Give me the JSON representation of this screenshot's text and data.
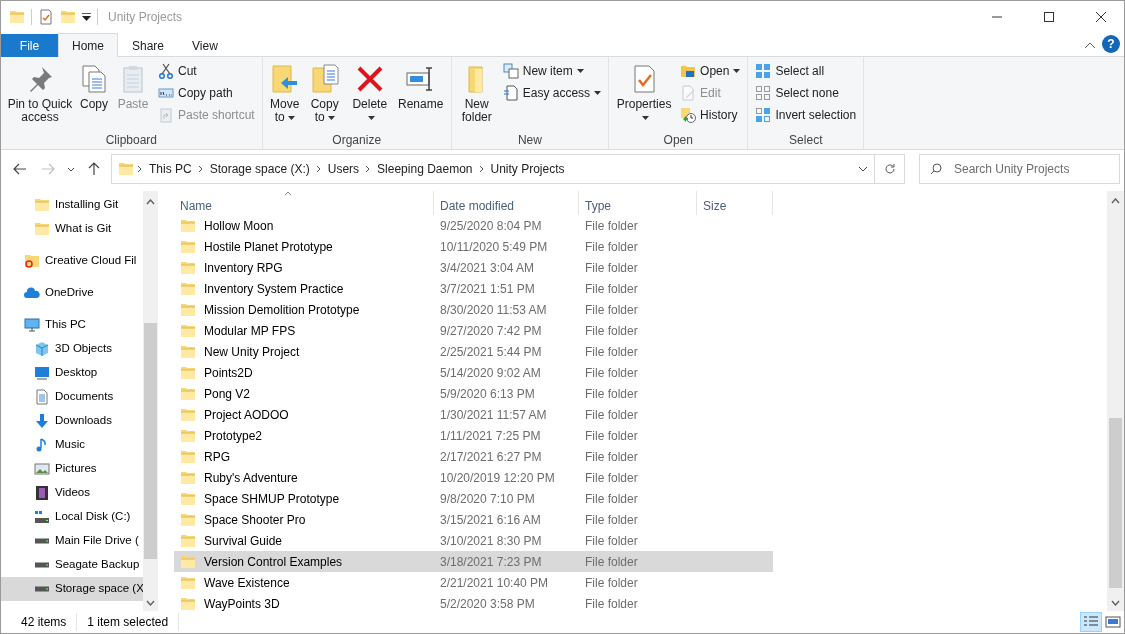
{
  "window": {
    "title": "Unity Projects"
  },
  "ribbon_tabs": [
    {
      "label": "File",
      "kind": "file",
      "selected": false
    },
    {
      "label": "Home",
      "kind": "tab",
      "selected": true
    },
    {
      "label": "Share",
      "kind": "tab",
      "selected": false
    },
    {
      "label": "View",
      "kind": "tab",
      "selected": false
    }
  ],
  "help_button": "?",
  "ribbon": {
    "groups": [
      {
        "label": "Clipboard",
        "items": [
          {
            "label": "Pin to Quick access",
            "kind": "large",
            "disabled": false,
            "dropdown": false
          },
          {
            "label": "Copy",
            "kind": "large",
            "disabled": false,
            "dropdown": false
          },
          {
            "label": "Paste",
            "kind": "large",
            "disabled": true,
            "dropdown": false
          },
          {
            "label": "Cut",
            "kind": "small",
            "disabled": false,
            "dropdown": false
          },
          {
            "label": "Copy path",
            "kind": "small",
            "disabled": false,
            "dropdown": false
          },
          {
            "label": "Paste shortcut",
            "kind": "small",
            "disabled": true,
            "dropdown": false
          }
        ]
      },
      {
        "label": "Organize",
        "items": [
          {
            "label": "Move to",
            "kind": "large",
            "disabled": false,
            "dropdown": true
          },
          {
            "label": "Copy to",
            "kind": "large",
            "disabled": false,
            "dropdown": true
          },
          {
            "label": "Delete",
            "kind": "large",
            "disabled": false,
            "dropdown": true
          },
          {
            "label": "Rename",
            "kind": "large",
            "disabled": false,
            "dropdown": false
          }
        ]
      },
      {
        "label": "New",
        "items": [
          {
            "label": "New folder",
            "kind": "large",
            "disabled": false,
            "dropdown": false
          },
          {
            "label": "New item",
            "kind": "small",
            "disabled": false,
            "dropdown": true
          },
          {
            "label": "Easy access",
            "kind": "small",
            "disabled": false,
            "dropdown": true
          }
        ]
      },
      {
        "label": "Open",
        "items": [
          {
            "label": "Properties",
            "kind": "large",
            "disabled": false,
            "dropdown": true
          },
          {
            "label": "Open",
            "kind": "small",
            "disabled": false,
            "dropdown": true
          },
          {
            "label": "Edit",
            "kind": "small",
            "disabled": true,
            "dropdown": false
          },
          {
            "label": "History",
            "kind": "small",
            "disabled": false,
            "dropdown": false
          }
        ]
      },
      {
        "label": "Select",
        "items": [
          {
            "label": "Select all",
            "kind": "small",
            "disabled": false,
            "dropdown": false
          },
          {
            "label": "Select none",
            "kind": "small",
            "disabled": false,
            "dropdown": false
          },
          {
            "label": "Invert selection",
            "kind": "small",
            "disabled": false,
            "dropdown": false
          }
        ]
      }
    ]
  },
  "address_bar": {
    "breadcrumbs": [
      "This PC",
      "Storage space (X:)",
      "Users",
      "Sleeping Daemon",
      "Unity Projects"
    ],
    "forward_disabled": true
  },
  "search": {
    "placeholder": "Search Unity Projects"
  },
  "navigation": {
    "pinned": [
      {
        "label": "Installing Git",
        "selected": false
      },
      {
        "label": "What is Git",
        "selected": false
      }
    ],
    "items": [
      {
        "label": "Creative Cloud Fil",
        "selected": false
      },
      {
        "label": "OneDrive",
        "selected": false
      },
      {
        "label": "This PC",
        "selected": false,
        "children": [
          {
            "label": "3D Objects",
            "selected": false
          },
          {
            "label": "Desktop",
            "selected": false
          },
          {
            "label": "Documents",
            "selected": false
          },
          {
            "label": "Downloads",
            "selected": false
          },
          {
            "label": "Music",
            "selected": false
          },
          {
            "label": "Pictures",
            "selected": false
          },
          {
            "label": "Videos",
            "selected": false
          },
          {
            "label": "Local Disk (C:)",
            "selected": false
          },
          {
            "label": "Main File Drive (",
            "selected": false
          },
          {
            "label": "Seagate Backup",
            "selected": false
          },
          {
            "label": "Storage space (X",
            "selected": true
          }
        ]
      }
    ]
  },
  "table": {
    "columns": [
      "Name",
      "Date modified",
      "Type",
      "Size"
    ],
    "rows": [
      {
        "name": "Hollow Moon",
        "date": "9/25/2020 8:04 PM",
        "type": "File folder",
        "selected": false
      },
      {
        "name": "Hostile Planet Prototype",
        "date": "10/11/2020 5:49 PM",
        "type": "File folder",
        "selected": false
      },
      {
        "name": "Inventory RPG",
        "date": "3/4/2021 3:04 AM",
        "type": "File folder",
        "selected": false
      },
      {
        "name": "Inventory System Practice",
        "date": "3/7/2021 1:51 PM",
        "type": "File folder",
        "selected": false
      },
      {
        "name": "Mission Demolition Prototype",
        "date": "8/30/2020 11:53 AM",
        "type": "File folder",
        "selected": false
      },
      {
        "name": "Modular MP FPS",
        "date": "9/27/2020 7:42 PM",
        "type": "File folder",
        "selected": false
      },
      {
        "name": "New Unity Project",
        "date": "2/25/2021 5:44 PM",
        "type": "File folder",
        "selected": false
      },
      {
        "name": "Points2D",
        "date": "5/14/2020 9:02 AM",
        "type": "File folder",
        "selected": false
      },
      {
        "name": "Pong V2",
        "date": "5/9/2020 6:13 PM",
        "type": "File folder",
        "selected": false
      },
      {
        "name": "Project AODOO",
        "date": "1/30/2021 11:57 AM",
        "type": "File folder",
        "selected": false
      },
      {
        "name": "Prototype2",
        "date": "1/11/2021 7:25 PM",
        "type": "File folder",
        "selected": false
      },
      {
        "name": "RPG",
        "date": "2/17/2021 6:27 PM",
        "type": "File folder",
        "selected": false
      },
      {
        "name": "Ruby's Adventure",
        "date": "10/20/2019 12:20 PM",
        "type": "File folder",
        "selected": false
      },
      {
        "name": "Space SHMUP Prototype",
        "date": "9/8/2020 7:10 PM",
        "type": "File folder",
        "selected": false
      },
      {
        "name": "Space Shooter Pro",
        "date": "3/15/2021 6:16 AM",
        "type": "File folder",
        "selected": false
      },
      {
        "name": "Survival Guide",
        "date": "3/10/2021 8:30 PM",
        "type": "File folder",
        "selected": false
      },
      {
        "name": "Version Control Examples",
        "date": "3/18/2021 7:23 PM",
        "type": "File folder",
        "selected": true
      },
      {
        "name": "Wave Existence",
        "date": "2/21/2021 10:40 PM",
        "type": "File folder",
        "selected": false
      },
      {
        "name": "WayPoints 3D",
        "date": "5/2/2020 3:58 PM",
        "type": "File folder",
        "selected": false
      }
    ]
  },
  "status_bar": {
    "item_count": "42 items",
    "selection": "1 item selected"
  },
  "views": [
    {
      "kind": "details",
      "selected": true
    },
    {
      "kind": "tiles",
      "selected": false
    }
  ]
}
